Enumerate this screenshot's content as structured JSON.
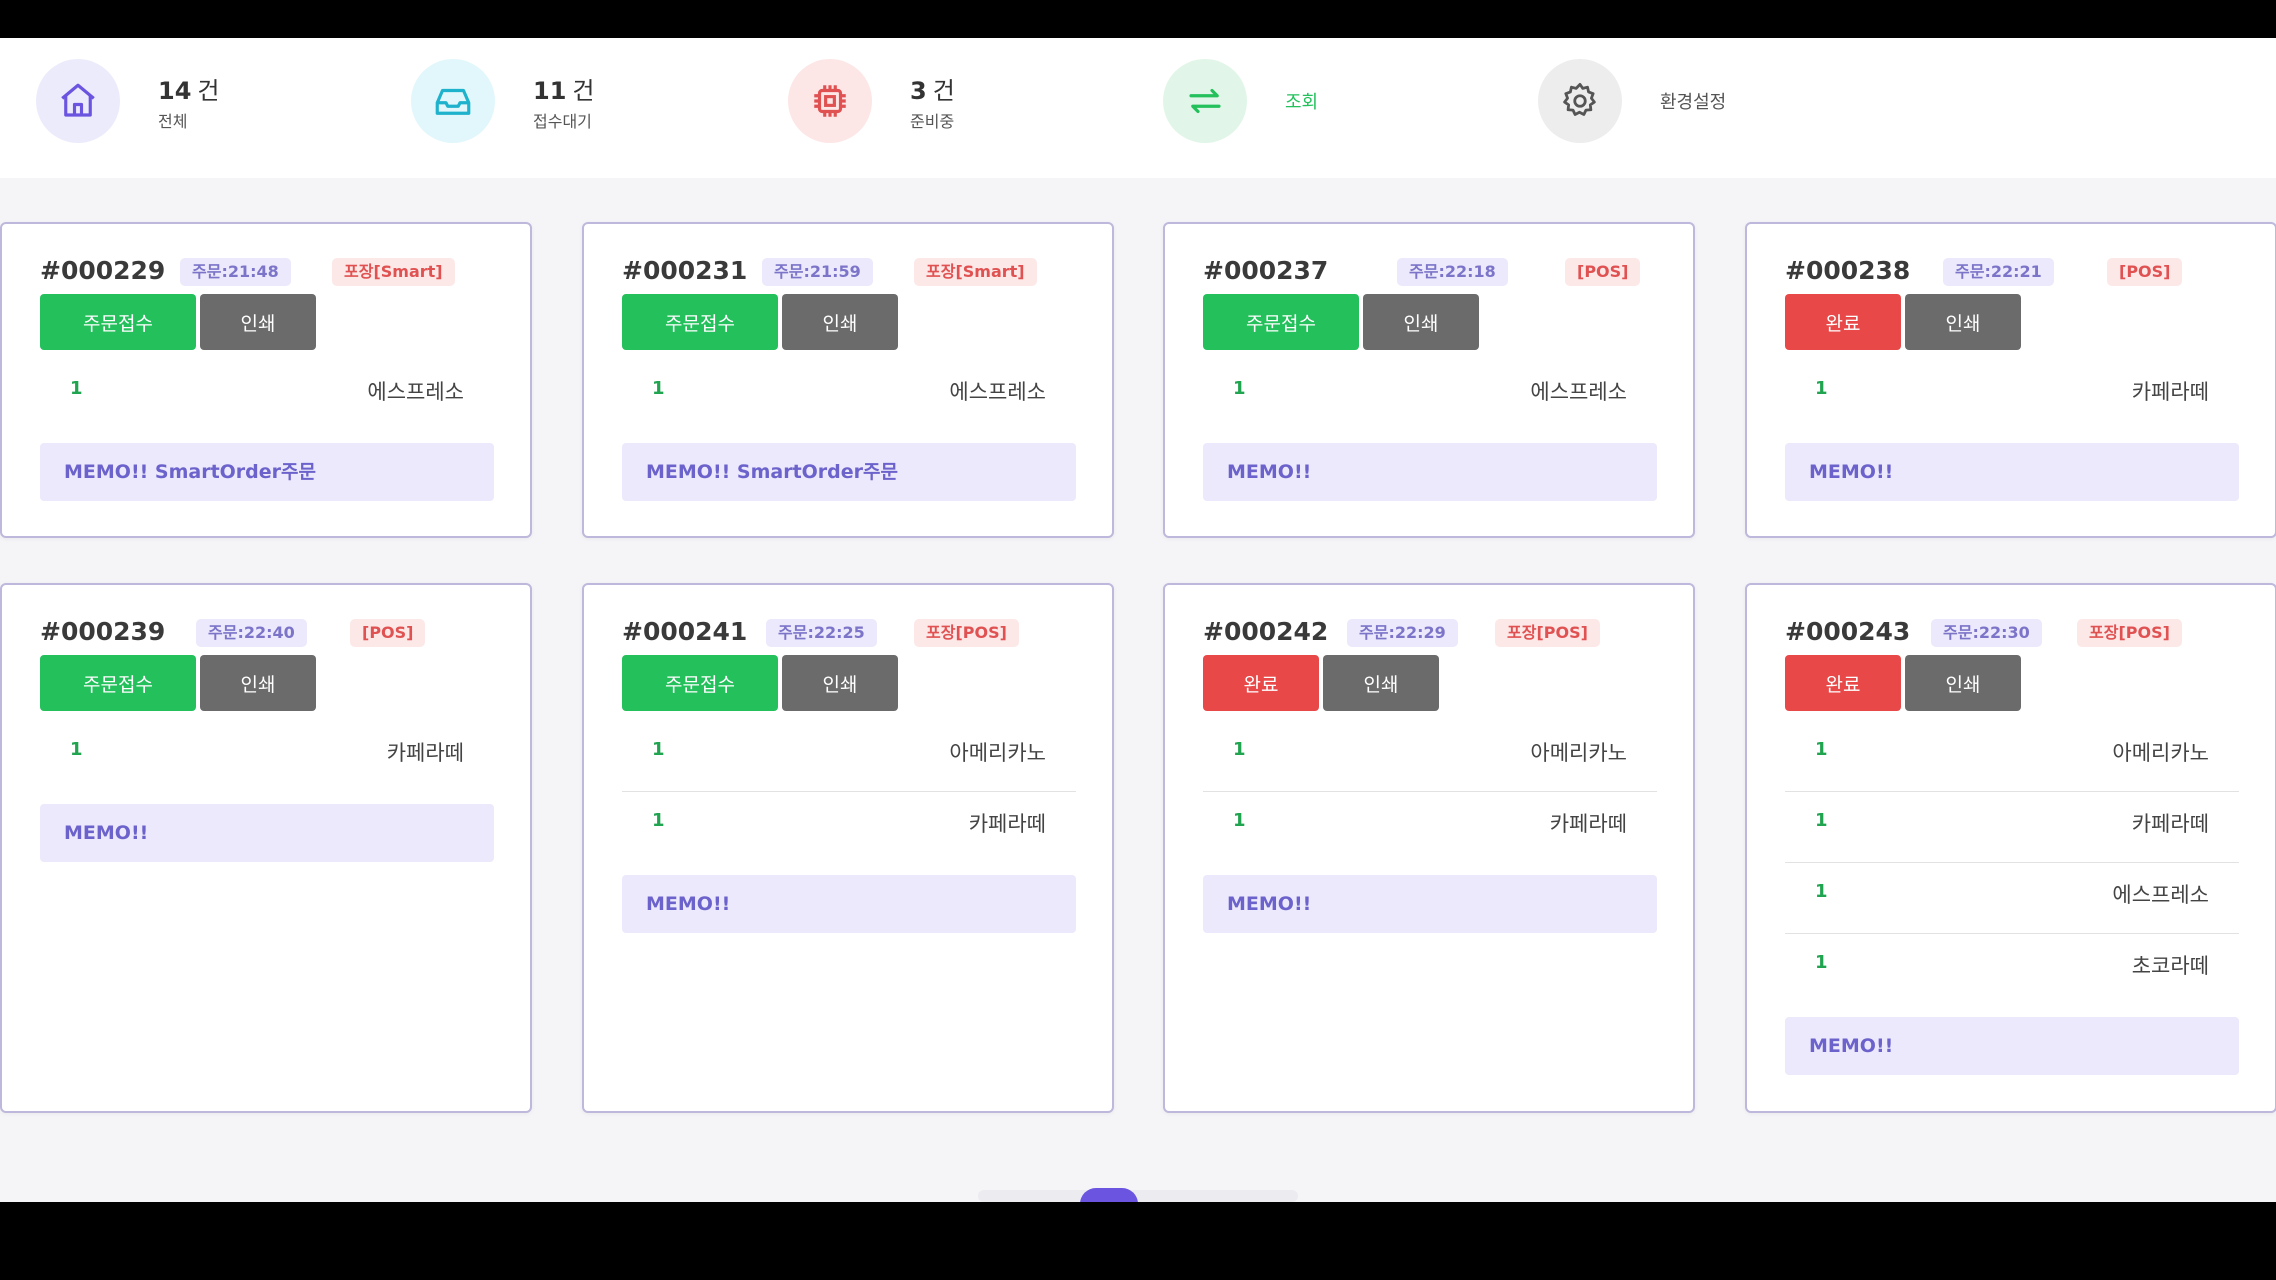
{
  "topbar": {
    "total": {
      "count": "14",
      "unit": "건",
      "label": "전체",
      "icon": "home-icon"
    },
    "waiting": {
      "count": "11",
      "unit": "건",
      "label": "접수대기",
      "icon": "inbox-icon"
    },
    "preparing": {
      "count": "3",
      "unit": "건",
      "label": "준비중",
      "icon": "chip-icon"
    },
    "lookup": {
      "label": "조회",
      "icon": "swap-arrows-icon"
    },
    "settings": {
      "label": "환경설정",
      "icon": "gear-icon"
    }
  },
  "colors": {
    "accent": "#6b55e0",
    "accept": "#24c05c",
    "done": "#e84848",
    "print": "#6b6b6b",
    "memo_bg": "#ebe9fb",
    "badge_type": "#e05252"
  },
  "orders": [
    {
      "no": "#000229",
      "time": "주문:21:48",
      "type": "포장[Smart]",
      "status_label": "주문접수",
      "status": "accept",
      "print_label": "인쇄",
      "items": [
        {
          "qty": "1",
          "name": "에스프레소"
        }
      ],
      "memo": "MEMO!! SmartOrder주문"
    },
    {
      "no": "#000231",
      "time": "주문:21:59",
      "type": "포장[Smart]",
      "status_label": "주문접수",
      "status": "accept",
      "print_label": "인쇄",
      "items": [
        {
          "qty": "1",
          "name": "에스프레소"
        }
      ],
      "memo": "MEMO!! SmartOrder주문"
    },
    {
      "no": "#000237",
      "time": "주문:22:18",
      "type": "[POS]",
      "status_label": "주문접수",
      "status": "accept",
      "print_label": "인쇄",
      "items": [
        {
          "qty": "1",
          "name": "에스프레소"
        }
      ],
      "memo": "MEMO!!"
    },
    {
      "no": "#000238",
      "time": "주문:22:21",
      "type": "[POS]",
      "status_label": "완료",
      "status": "done",
      "print_label": "인쇄",
      "items": [
        {
          "qty": "1",
          "name": "카페라떼"
        }
      ],
      "memo": "MEMO!!"
    },
    {
      "no": "#000239",
      "time": "주문:22:40",
      "type": "[POS]",
      "status_label": "주문접수",
      "status": "accept",
      "print_label": "인쇄",
      "items": [
        {
          "qty": "1",
          "name": "카페라떼"
        }
      ],
      "memo": "MEMO!!"
    },
    {
      "no": "#000241",
      "time": "주문:22:25",
      "type": "포장[POS]",
      "status_label": "주문접수",
      "status": "accept",
      "print_label": "인쇄",
      "items": [
        {
          "qty": "1",
          "name": "아메리카노"
        },
        {
          "qty": "1",
          "name": "카페라떼"
        }
      ],
      "memo": "MEMO!!"
    },
    {
      "no": "#000242",
      "time": "주문:22:29",
      "type": "포장[POS]",
      "status_label": "완료",
      "status": "done",
      "print_label": "인쇄",
      "items": [
        {
          "qty": "1",
          "name": "아메리카노"
        },
        {
          "qty": "1",
          "name": "카페라떼"
        }
      ],
      "memo": "MEMO!!"
    },
    {
      "no": "#000243",
      "time": "주문:22:30",
      "type": "포장[POS]",
      "status_label": "완료",
      "status": "done",
      "print_label": "인쇄",
      "items": [
        {
          "qty": "1",
          "name": "아메리카노"
        },
        {
          "qty": "1",
          "name": "카페라떼"
        },
        {
          "qty": "1",
          "name": "에스프레소"
        },
        {
          "qty": "1",
          "name": "초코라떼"
        }
      ],
      "memo": "MEMO!!"
    }
  ]
}
